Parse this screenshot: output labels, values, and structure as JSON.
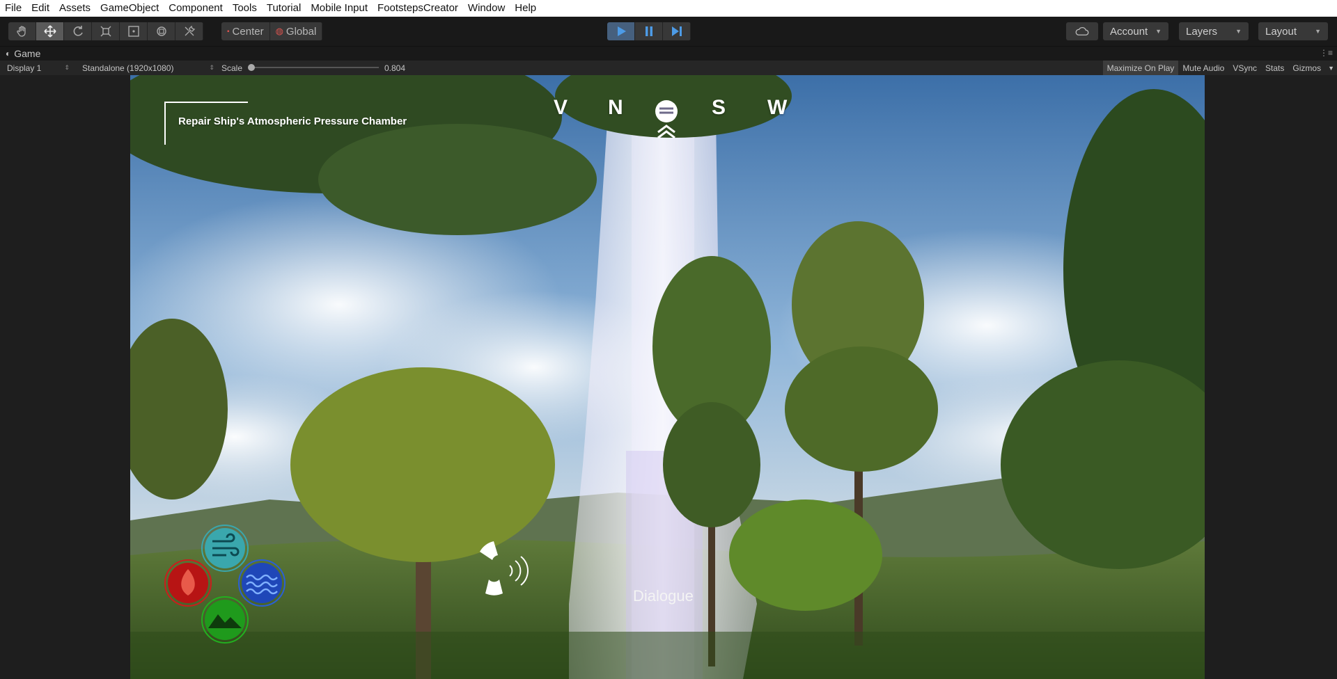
{
  "menu": [
    "File",
    "Edit",
    "Assets",
    "GameObject",
    "Component",
    "Tools",
    "Tutorial",
    "Mobile Input",
    "FootstepsCreator",
    "Window",
    "Help"
  ],
  "toolbar": {
    "tools": [
      {
        "name": "hand-tool",
        "icon": "hand-icon"
      },
      {
        "name": "move-tool",
        "icon": "move-icon"
      },
      {
        "name": "rotate-tool",
        "icon": "rotate-icon"
      },
      {
        "name": "scale-tool",
        "icon": "scale-icon"
      },
      {
        "name": "rect-tool",
        "icon": "rect-icon"
      },
      {
        "name": "transform-tool",
        "icon": "transform-icon"
      },
      {
        "name": "custom-tool",
        "icon": "wrench-icon"
      }
    ],
    "pivot_label": "Center",
    "rotation_label": "Global",
    "account_label": "Account",
    "layers_label": "Layers",
    "layout_label": "Layout"
  },
  "game_tab": {
    "label": "Game"
  },
  "game_bar": {
    "display": "Display 1",
    "resolution": "Standalone (1920x1080)",
    "scale_label": "Scale",
    "scale_value": "0.804",
    "buttons": [
      "Maximize On Play",
      "Mute Audio",
      "VSync",
      "Stats",
      "Gizmos"
    ]
  },
  "hud": {
    "objective": "Repair Ship's Atmospheric Pressure Chamber",
    "compass": [
      "V",
      "N",
      "S",
      "W"
    ],
    "dialogue": "Dialogue",
    "elements": [
      "wind-element-icon",
      "fire-element-icon",
      "water-element-icon",
      "earth-element-icon"
    ]
  },
  "colors": {
    "play_active": "#46607e",
    "accent_blue": "#4d9be6",
    "wind": "#3aa7ad",
    "fire": "#cc1c1c",
    "water": "#2a5fd6",
    "earth": "#22b01f"
  }
}
